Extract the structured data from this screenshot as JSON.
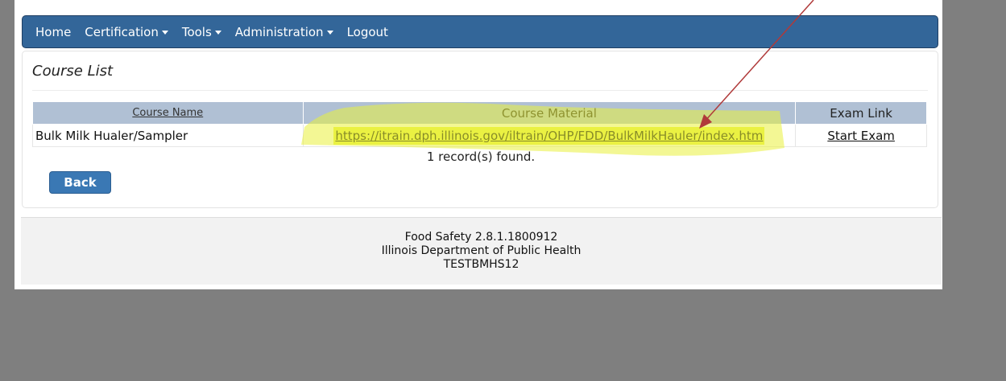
{
  "nav": {
    "items": [
      {
        "label": "Home",
        "dropdown": false
      },
      {
        "label": "Certification",
        "dropdown": true
      },
      {
        "label": "Tools",
        "dropdown": true
      },
      {
        "label": "Administration",
        "dropdown": true
      },
      {
        "label": "Logout",
        "dropdown": false
      }
    ]
  },
  "panel": {
    "title": "Course List"
  },
  "table": {
    "headers": {
      "course_name": "Course Name",
      "course_material": "Course Material",
      "exam_link": "Exam Link"
    },
    "rows": [
      {
        "course_name": "Bulk Milk Hualer/Sampler",
        "course_material": "https://itrain.dph.illinois.gov/iltrain/OHP/FDD/BulkMilkHauler/index.htm",
        "exam_link": "Start Exam"
      }
    ],
    "record_count": "1 record(s) found."
  },
  "actions": {
    "back_label": "Back"
  },
  "footer": {
    "version": "Food Safety 2.8.1.1800912",
    "organization": "Illinois Department of Public Health",
    "user": "TESTBMHS12"
  },
  "colors": {
    "navbar": "#336699",
    "highlight": "#ecf24a",
    "annotation_arrow": "#b03a3a",
    "backdrop": "#7f7f7f"
  }
}
